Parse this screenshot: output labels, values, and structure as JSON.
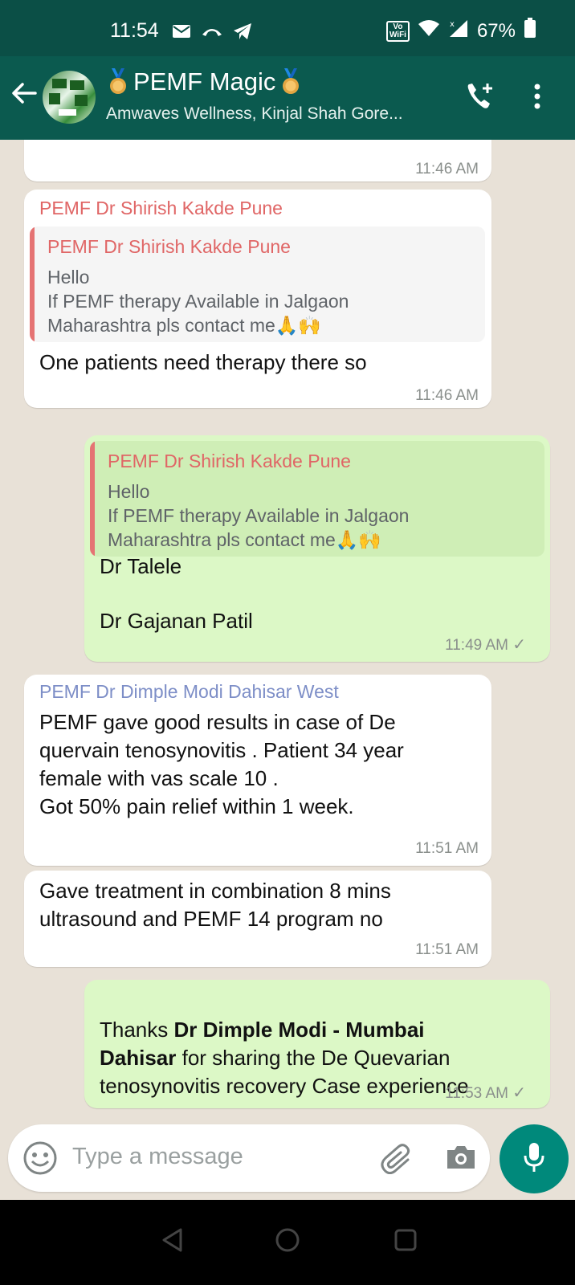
{
  "status_bar": {
    "time": "11:54",
    "volte": "Vo\nWiFi",
    "battery": "67%",
    "icons": [
      "mail-icon",
      "missed-call-icon",
      "telegram-icon",
      "vowifi-icon",
      "wifi-icon",
      "signal-icon",
      "battery-icon"
    ]
  },
  "header": {
    "title": "PEMF Magic",
    "subtitle": "Amwaves Wellness, Kinjal Shah Gore...",
    "icons": [
      "back-arrow-icon",
      "group-avatar",
      "medal-icon",
      "add-call-icon",
      "more-vert-icon"
    ]
  },
  "messages": [
    {
      "direction": "in",
      "time": "11:46 AM"
    },
    {
      "direction": "in",
      "sender": "PEMF Dr Shirish Kakde Pune",
      "quote": {
        "name": "PEMF Dr Shirish Kakde Pune",
        "text": "Hello\nIf PEMF therapy Available in Jalgaon\nMaharashtra pls contact me🙏🙌"
      },
      "text": "One patients need therapy there so",
      "time": "11:46 AM"
    },
    {
      "direction": "out",
      "quote": {
        "name": "PEMF Dr Shirish Kakde Pune",
        "text": "Hello\nIf PEMF therapy Available in Jalgaon\nMaharashtra pls contact me🙏🙌"
      },
      "text": "Dr Talele\n\nDr Gajanan Patil",
      "time": "11:49 AM",
      "ticks": "✓"
    },
    {
      "direction": "in",
      "sender": "PEMF Dr Dimple Modi Dahisar West",
      "text": "PEMF gave good results in case of De\nquervain tenosynovitis . Patient 34 year\nfemale with vas scale 10 .\nGot 50% pain relief within 1 week.",
      "time": "11:51 AM"
    },
    {
      "direction": "in",
      "text": "Gave treatment in combination 8 mins\nultrasound and PEMF 14 program no",
      "time": "11:51 AM"
    },
    {
      "direction": "out",
      "text_parts": [
        "Thanks ",
        "Dr Dimple Modi - Mumbai",
        "Dahisar",
        "  for sharing the De Quevarian",
        "tenosynovitis recovery Case experience"
      ],
      "time": "11:53 AM",
      "ticks": "✓"
    }
  ],
  "composer": {
    "placeholder": "Type a message",
    "icons": [
      "emoji-icon",
      "attach-icon",
      "camera-icon",
      "mic-icon"
    ]
  },
  "colors": {
    "status_bar": "#0b4f46",
    "header": "#0b5a4f",
    "incoming_bubble": "#ffffff",
    "outgoing_bubble": "#dcf8c6",
    "sender_red": "#e06666",
    "sender_blue": "#7d8ec7",
    "mic_button": "#00897b",
    "chat_background": "#e8e1d7"
  }
}
